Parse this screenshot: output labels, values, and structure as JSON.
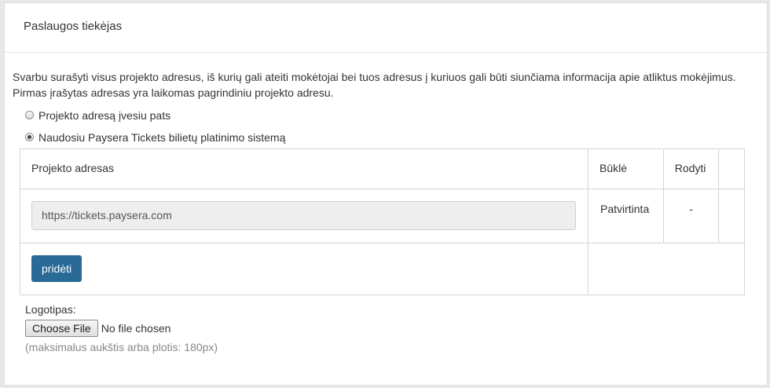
{
  "panel": {
    "title": "Paslaugos tiekėjas"
  },
  "intro": {
    "line1": "Svarbu surašyti visus projekto adresus, iš kurių gali ateiti mokėtojai bei tuos adresus į kuriuos gali būti siunčiama informacija apie atliktus mokėjimus.",
    "line2": "Pirmas įrašytas adresas yra laikomas pagrindiniu projekto adresu."
  },
  "options": [
    {
      "label": "Projekto adresą įvesiu pats",
      "checked": false
    },
    {
      "label": "Naudosiu Paysera Tickets bilietų platinimo sistemą",
      "checked": true
    }
  ],
  "table": {
    "headers": {
      "address": "Projekto adresas",
      "state": "Būklė",
      "show": "Rodyti"
    },
    "rows": [
      {
        "address": "https://tickets.paysera.com",
        "state": "Patvirtinta",
        "show": "-"
      }
    ],
    "add_button": "pridėti"
  },
  "logo": {
    "label": "Logotipas:",
    "choose_button": "Choose File",
    "no_file": "No file chosen",
    "hint": "(maksimalus aukštis arba plotis: 180px)"
  }
}
